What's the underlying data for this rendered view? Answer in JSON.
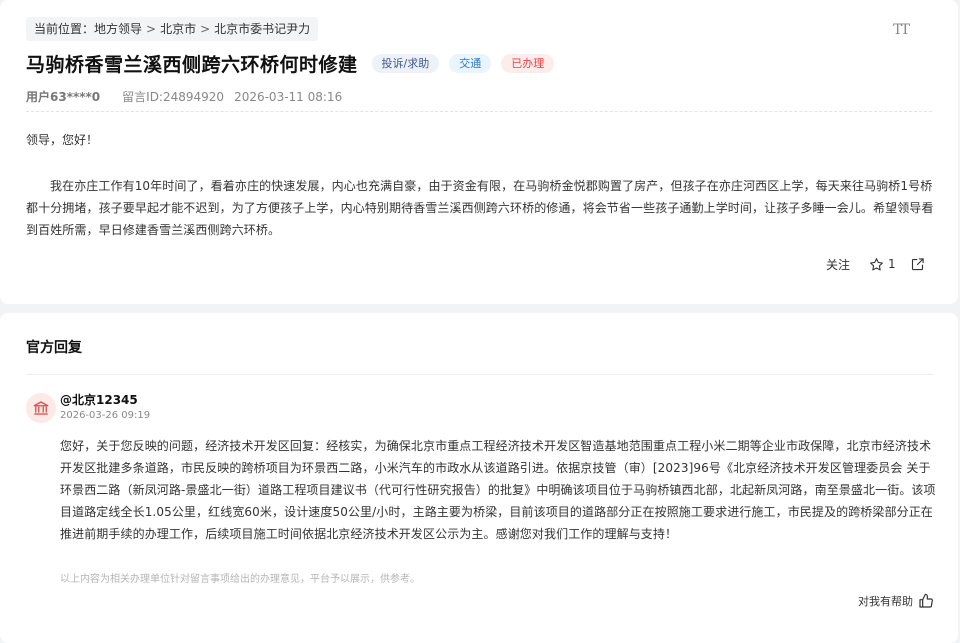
{
  "breadcrumb": {
    "label": "当前位置：",
    "items": [
      "地方领导",
      "北京市",
      "北京市委书记尹力"
    ],
    "separator": ">"
  },
  "font_size_button": "TT",
  "message": {
    "title": "马驹桥香雪兰溪西侧跨六环桥何时修建",
    "tags": {
      "category": "投诉/求助",
      "topic": "交通",
      "status": "已办理"
    },
    "user": "用户63****0",
    "message_id": "留言ID:24894920",
    "datetime": "2026-03-11 08:16",
    "greeting": "领导，您好！",
    "body": "我在亦庄工作有10年时间了，看着亦庄的快速发展，内心也充满自豪，由于资金有限，在马驹桥金悦郡购置了房产，但孩子在亦庄河西区上学，每天来往马驹桥1号桥都十分拥堵，孩子要早起才能不迟到，为了方便孩子上学，内心特别期待香雪兰溪西侧跨六环桥的修通，将会节省一些孩子通勤上学时间，让孩子多睡一会儿。希望领导看到百姓所需，早日修建香雪兰溪西侧跨六环桥。",
    "actions": {
      "follow": "关注",
      "like_count": "1"
    }
  },
  "reply": {
    "section_title": "官方回复",
    "replier": "@北京12345",
    "datetime": "2026-03-26 09:19",
    "body": "您好，关于您反映的问题，经济技术开发区回复：经核实，为确保北京市重点工程经济技术开发区智造基地范围重点工程小米二期等企业市政保障，北京市经济技术开发区批建多条道路，市民反映的跨桥项目为环景西二路，小米汽车的市政水从该道路引进。依据京技管（审）[2023]96号《北京经济技术开发区管理委员会 关于环景西二路（新凤河路-景盛北一街）道路工程项目建议书（代可行性研究报告）的批复》中明确该项目位于马驹桥镇西北部，北起新凤河路，南至景盛北一街。该项目道路定线全长1.05公里，红线宽60米，设计速度50公里/小时，主路主要为桥梁，目前该项目的道路部分正在按照施工要求进行施工，市民提及的跨桥梁部分正在推进前期手续的办理工作，后续项目施工时间依据北京经济技术开发区公示为主。感谢您对我们工作的理解与支持！",
    "disclaimer": "以上内容为相关办理单位针对留言事项给出的办理意见，平台予以展示，供参考。",
    "helpful": "对我有帮助"
  },
  "colors": {
    "status_red": "#e54545",
    "topic_blue": "#2a7ac8",
    "avatar_bg": "#fde9e6",
    "avatar_icon": "#d9534f"
  },
  "icons": [
    "star-icon",
    "share-icon",
    "government-building-icon",
    "thumbs-up-icon",
    "font-size-icon"
  ]
}
